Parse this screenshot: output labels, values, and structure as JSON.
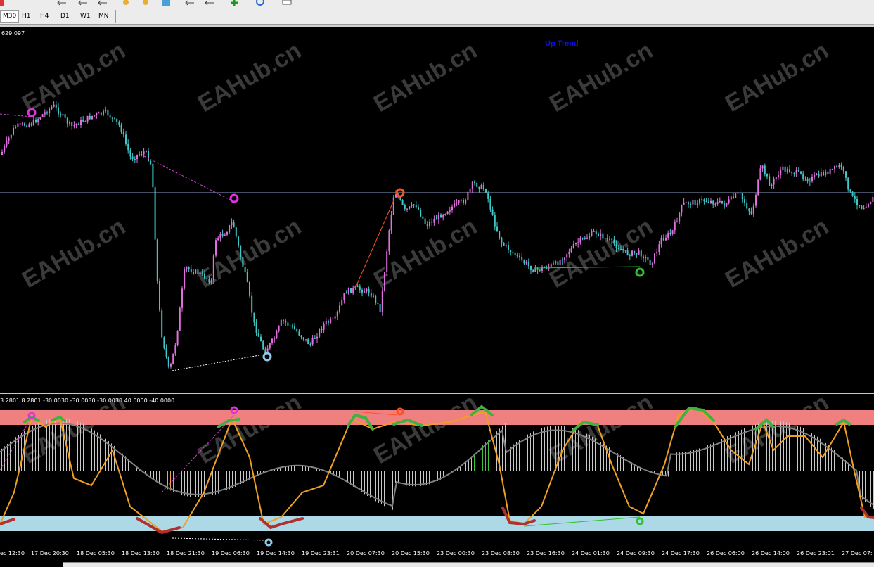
{
  "timeframes": [
    {
      "label": "M30",
      "active": true
    },
    {
      "label": "H1",
      "active": false
    },
    {
      "label": "H4",
      "active": false
    },
    {
      "label": "D1",
      "active": false
    },
    {
      "label": "W1",
      "active": false
    },
    {
      "label": "MN",
      "active": false
    }
  ],
  "price_label": "629.097",
  "trend_label": "Up Trend",
  "indicator_label": "3.2801 8.2801 -30.0030 -30.0030 -30.0030 40.0000 -40.0000",
  "watermark": "EAHub.cn",
  "x_ticks": [
    "ec 12:30",
    "17 Dec 20:30",
    "18 Dec 05:30",
    "18 Dec 13:30",
    "18 Dec 21:30",
    "19 Dec 06:30",
    "19 Dec 14:30",
    "19 Dec 23:31",
    "20 Dec 07:30",
    "20 Dec 15:30",
    "23 Dec 00:30",
    "23 Dec 08:30",
    "23 Dec 16:30",
    "24 Dec 01:30",
    "24 Dec 09:30",
    "24 Dec 17:30",
    "26 Dec 06:00",
    "26 Dec 14:00",
    "26 Dec 23:01",
    "27 Dec 07:"
  ],
  "colors": {
    "bull": "#e070e0",
    "bear": "#40c8c8",
    "overbought_band": "#f08080",
    "oversold_band": "#add8e6",
    "signal_line": "#f0a020",
    "histogram": "#c0c0c0",
    "trend_text": "#1010e0"
  },
  "icons": [
    "arrow-left-icon",
    "arrow-left-icon",
    "zoom-in-icon",
    "zoom-out-icon",
    "tile-icon",
    "scroll-icon",
    "shift-icon",
    "add-indicator-icon",
    "clock-icon",
    "template-icon"
  ]
}
